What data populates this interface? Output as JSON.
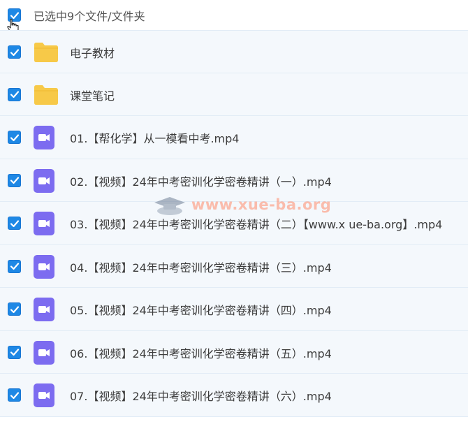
{
  "header": {
    "selection_text": "已选中9个文件/文件夹"
  },
  "files": [
    {
      "name": "电子教材",
      "type": "folder"
    },
    {
      "name": "课堂笔记",
      "type": "folder"
    },
    {
      "name": "01.【帮化学】从一模看中考.mp4",
      "type": "video"
    },
    {
      "name": "02.【视频】24年中考密训化学密卷精讲（一）.mp4",
      "type": "video"
    },
    {
      "name": "03.【视频】24年中考密训化学密卷精讲（二）【www.x ue-ba.org】.mp4",
      "type": "video"
    },
    {
      "name": "04.【视频】24年中考密训化学密卷精讲（三）.mp4",
      "type": "video"
    },
    {
      "name": "05.【视频】24年中考密训化学密卷精讲（四）.mp4",
      "type": "video"
    },
    {
      "name": "06.【视频】24年中考密训化学密卷精讲（五）.mp4",
      "type": "video"
    },
    {
      "name": "07.【视频】24年中考密训化学密卷精讲（六）.mp4",
      "type": "video"
    }
  ],
  "watermark": {
    "text": "www.xue-ba.org"
  },
  "colors": {
    "checkbox": "#1e88e5",
    "folder": "#f7c948",
    "video": "#7c6cf0",
    "row_bg": "#f4f8fc"
  }
}
